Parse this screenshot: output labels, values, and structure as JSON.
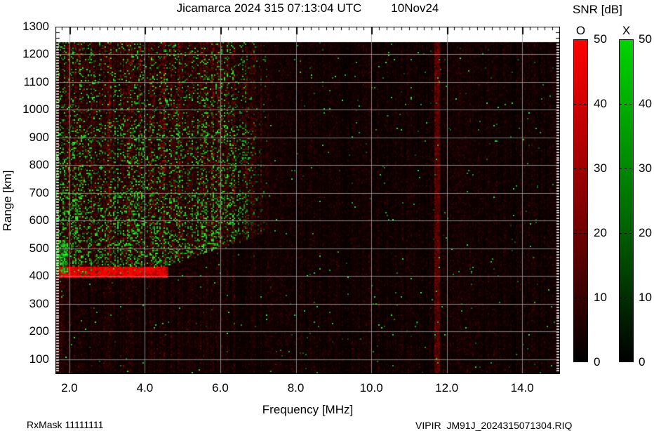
{
  "title": {
    "left": "Jicamarca 2024 315 07:13:04 UTC",
    "right": "10Nov24"
  },
  "footer": {
    "rx_mask": "RxMask 11111111",
    "file": "VIPIR  JM91J_2024315071304.RIQ"
  },
  "colorbar": {
    "title": "SNR [dB]",
    "vmin": 0,
    "vmax": 50,
    "ticks": [
      50,
      40,
      30,
      20,
      10,
      0
    ],
    "dash_values": [
      40,
      30,
      20,
      10
    ],
    "bars": [
      {
        "label": "O",
        "top_color": "#ff0000",
        "bottom_color": "#000000"
      },
      {
        "label": "X",
        "top_color": "#00d400",
        "bottom_color": "#000000"
      }
    ]
  },
  "chart_data": {
    "type": "heatmap",
    "title": "Jicamarca 2024 315 07:13:04 UTC 10Nov24",
    "xlabel": "Frequency [MHz]",
    "ylabel": "Range [km]",
    "xlim": [
      1.63,
      15.0
    ],
    "ylim": [
      46,
      1300
    ],
    "xticks": [
      2,
      4,
      6,
      8,
      10,
      12,
      14
    ],
    "xtick_labels": [
      "2.0",
      "4.0",
      "6.0",
      "8.0",
      "10.0",
      "12.0",
      "14.0"
    ],
    "yticks": [
      1300,
      1200,
      1100,
      1000,
      900,
      800,
      700,
      600,
      500,
      400,
      300,
      200,
      100
    ],
    "ytick_labels": [
      "1300",
      "1200",
      "1100",
      "1000",
      "900",
      "800",
      "700",
      "600",
      "500",
      "400",
      "300",
      "200",
      "100"
    ],
    "grid": true,
    "grid_color": "#8c8c8c",
    "snr_scale": {
      "min": 0,
      "max": 50,
      "units": "dB",
      "o_trace_color": "red",
      "x_trace_color": "green"
    },
    "max_sounded_range_km": 1245,
    "echo_region": {
      "freq_range_mhz": [
        1.63,
        6.35
      ],
      "fade_tail_mhz": 7.3,
      "top_km": 1245,
      "red_density": 0.5,
      "bottom_edge": [
        [
          1.63,
          390
        ],
        [
          3.9,
          402
        ],
        [
          4.3,
          430
        ],
        [
          5.0,
          450
        ],
        [
          5.6,
          482
        ],
        [
          6.0,
          503
        ],
        [
          6.6,
          524
        ],
        [
          7.3,
          560
        ]
      ],
      "green_density_bands": [
        [
          400,
          700,
          0.32
        ],
        [
          700,
          950,
          0.22
        ],
        [
          950,
          1245,
          0.14
        ]
      ]
    },
    "bright_red_band": {
      "freq_range_mhz": [
        1.7,
        4.6
      ],
      "range_km": [
        393,
        432
      ]
    },
    "left_green_column": {
      "freq_range_mhz": [
        1.63,
        1.95
      ],
      "range_km": [
        408,
        530
      ]
    },
    "interference_lines_mhz": [
      11.75
    ],
    "background_noise": {
      "description": "faint dark-red vertical speckle striping over black, sparse green speckles",
      "green_speckle_probability": 0.006
    }
  }
}
